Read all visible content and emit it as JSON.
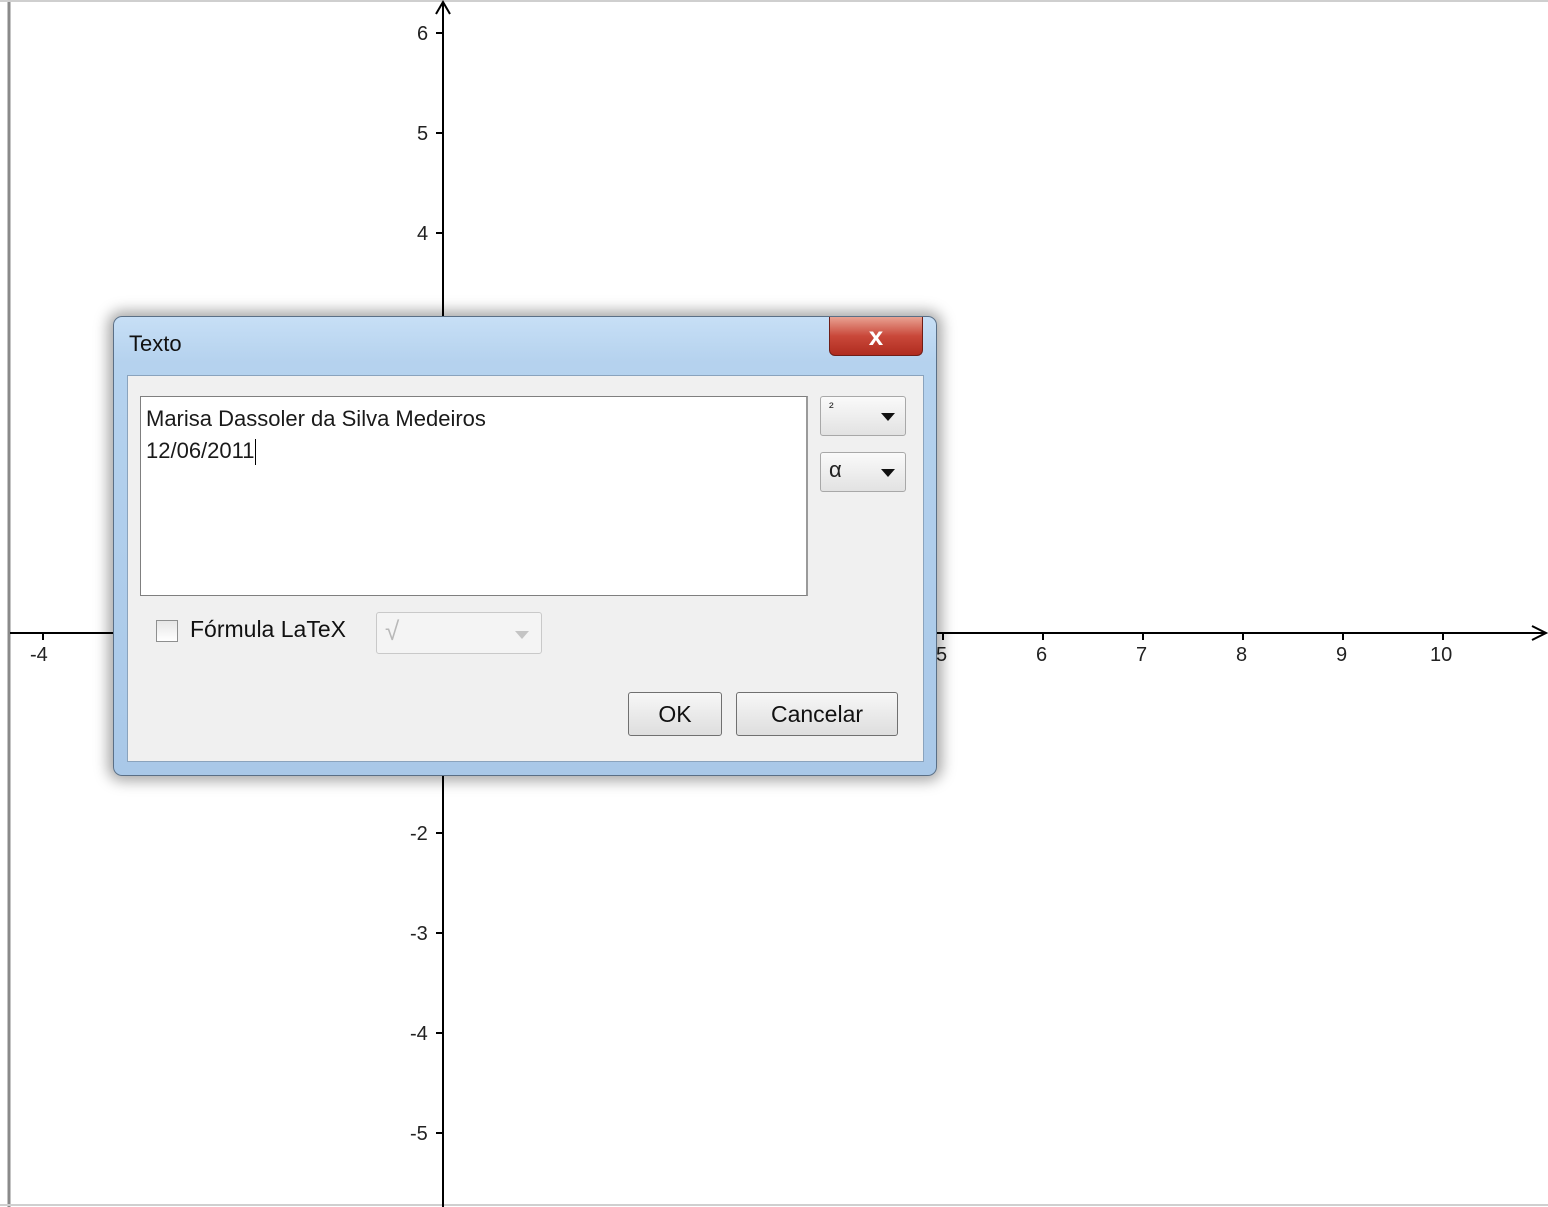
{
  "graph": {
    "x_axis_labels": [
      "-4",
      "5",
      "6",
      "7",
      "8",
      "9",
      "10"
    ],
    "y_axis_labels": [
      "6",
      "5",
      "4",
      "-2",
      "-3",
      "-4",
      "-5"
    ]
  },
  "dialog": {
    "title": "Texto",
    "close_label": "x",
    "text_lines": [
      "Marisa Dassoler da Silva Medeiros",
      "12/06/2011"
    ],
    "superscript_combo": "²",
    "greek_combo": "α",
    "latex_checkbox_label": "Fórmula LaTeX",
    "latex_checked": false,
    "latex_combo": "√",
    "ok_label": "OK",
    "cancel_label": "Cancelar"
  }
}
